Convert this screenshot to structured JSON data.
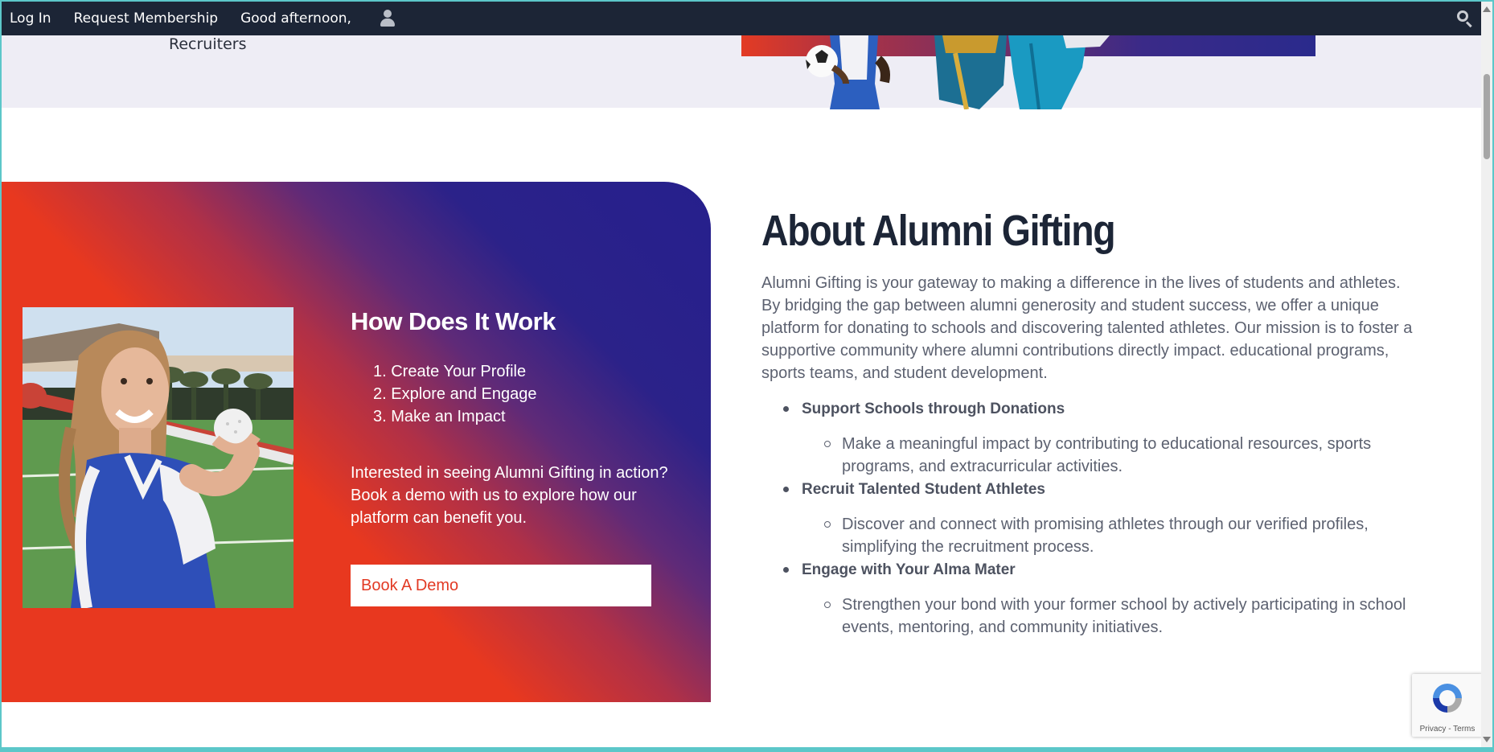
{
  "topbar": {
    "login_label": "Log In",
    "request_label": "Request Membership",
    "greeting": "Good afternoon,"
  },
  "hero": {
    "recruiters_label": "Recruiters"
  },
  "how_it_works": {
    "title": "How Does It Work",
    "steps": [
      "1. Create Your Profile",
      "2. Explore and Engage",
      "3. Make an Impact"
    ],
    "paragraph": "Interested in seeing Alumni Gifting in action? Book a demo with us to explore how our platform can benefit you.",
    "button_label": "Book A Demo"
  },
  "about": {
    "title": "About Alumni Gifting",
    "intro": "Alumni Gifting is your gateway to making a difference in the lives of students and athletes. By bridging the gap between alumni generosity and student success, we offer a unique platform for donating to schools and discovering talented athletes. Our mission is to foster a supportive community where alumni contributions directly impact. educational programs, sports teams, and student development.",
    "points": [
      {
        "heading": "Support Schools through Donations",
        "detail": "Make a meaningful impact by contributing to educational resources, sports programs, and extracurricular activities."
      },
      {
        "heading": "Recruit Talented Student Athletes",
        "detail": "Discover and connect with promising athletes through our verified profiles, simplifying the recruitment process."
      },
      {
        "heading": "Engage with Your Alma Mater",
        "detail": "Strengthen your bond with your former school by actively participating in school events, mentoring, and community initiatives."
      }
    ]
  },
  "recaptcha": {
    "terms": "Privacy - Terms"
  },
  "colors": {
    "topbar_bg": "#1c2536",
    "accent_red": "#e8381f",
    "accent_blue": "#261f8d",
    "heading_dark": "#1c2536"
  }
}
